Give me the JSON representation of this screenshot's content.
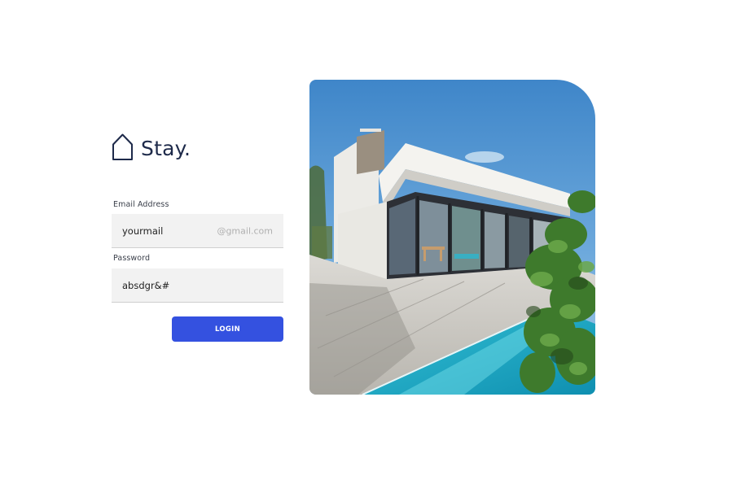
{
  "brand": {
    "name": "Stay.",
    "color": "#1e2a4a"
  },
  "form": {
    "email": {
      "label": "Email Address",
      "value": "yourmail",
      "suffix": "@gmail.com"
    },
    "password": {
      "label": "Password",
      "value": "absdgr&#"
    },
    "login_label": "LOGIN",
    "accent_color": "#3451e0"
  },
  "hero": {
    "icon": "modern-house-with-pool-photo"
  }
}
